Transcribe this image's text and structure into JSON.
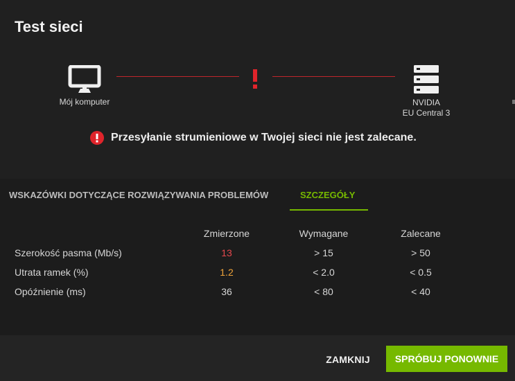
{
  "dialog": {
    "title": "Test sieci"
  },
  "diagram": {
    "computer_label": "Mój komputer",
    "server_label_line1": "NVIDIA",
    "server_label_line2": "EU Central 3",
    "status_icon": "exclamation-icon"
  },
  "banner": {
    "icon": "alert-circle-icon",
    "message": "Przesyłanie strumieniowe w Twojej sieci nie jest zalecane."
  },
  "tabs": [
    {
      "label": "WSKAZÓWKI DOTYCZĄCE ROZWIĄZYWANIA PROBLEMÓW",
      "active": false
    },
    {
      "label": "SZCZEGÓŁY",
      "active": true
    }
  ],
  "details": {
    "columns": [
      "Zmierzone",
      "Wymagane",
      "Zalecane"
    ],
    "rows": [
      {
        "label": "Szerokość pasma (Mb/s)",
        "measured": "13",
        "required": "> 15",
        "recommended": "> 50",
        "measured_color": "#e5484d"
      },
      {
        "label": "Utrata ramek (%)",
        "measured": "1.2",
        "required": "< 2.0",
        "recommended": "< 0.5",
        "measured_color": "#f0a43a"
      },
      {
        "label": "Opóźnienie (ms)",
        "measured": "36",
        "required": "< 80",
        "recommended": "< 40",
        "measured_color": "#d6d6d6"
      }
    ]
  },
  "footer": {
    "close_label": "ZAMKNIJ",
    "retry_label": "SPRÓBUJ PONOWNIE"
  },
  "colors": {
    "accent": "#76b900",
    "error": "#e5484d",
    "warning": "#f0a43a"
  }
}
